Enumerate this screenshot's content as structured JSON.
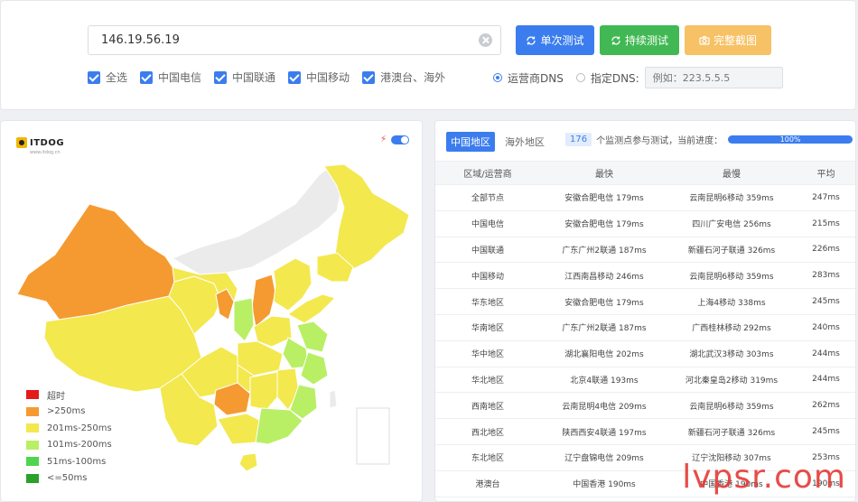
{
  "search": {
    "value": "146.19.56.19"
  },
  "buttons": {
    "single": "单次测试",
    "continuous": "持续测试",
    "screenshot": "完整截图"
  },
  "filters": [
    "全选",
    "中国电信",
    "中国联通",
    "中国移动",
    "港澳台、海外"
  ],
  "dns": {
    "isp_label": "运营商DNS",
    "custom_label": "指定DNS:",
    "placeholder": "例如：223.5.5.5"
  },
  "map": {
    "logo": "ITDOG",
    "logo_sub": "www.itdog.cn",
    "legend": [
      {
        "label": "超时",
        "color": "#e41b1b"
      },
      {
        "label": ">250ms",
        "color": "#f59a31"
      },
      {
        "label": "201ms-250ms",
        "color": "#f3e84e"
      },
      {
        "label": "101ms-200ms",
        "color": "#b8ef65"
      },
      {
        "label": "51ms-100ms",
        "color": "#4fd54d"
      },
      {
        "label": "<=50ms",
        "color": "#2aa12a"
      }
    ]
  },
  "results": {
    "tabs": [
      "中国地区",
      "海外地区"
    ],
    "count": "176",
    "count_text": "个监测点参与测试，当前进度：",
    "progress": "100%",
    "headers": [
      "区域/运营商",
      "最快",
      "最慢",
      "平均"
    ],
    "rows": [
      [
        "全部节点",
        "安徽合肥电信 179ms",
        "云南昆明6移动 359ms",
        "247ms"
      ],
      [
        "中国电信",
        "安徽合肥电信 179ms",
        "四川广安电信 256ms",
        "215ms"
      ],
      [
        "中国联通",
        "广东广州2联通 187ms",
        "新疆石河子联通 326ms",
        "226ms"
      ],
      [
        "中国移动",
        "江西南昌移动 246ms",
        "云南昆明6移动 359ms",
        "283ms"
      ],
      [
        "华东地区",
        "安徽合肥电信 179ms",
        "上海4移动 338ms",
        "245ms"
      ],
      [
        "华南地区",
        "广东广州2联通 187ms",
        "广西桂林移动 292ms",
        "240ms"
      ],
      [
        "华中地区",
        "湖北襄阳电信 202ms",
        "湖北武汉3移动 303ms",
        "244ms"
      ],
      [
        "华北地区",
        "北京4联通 193ms",
        "河北秦皇岛2移动 319ms",
        "244ms"
      ],
      [
        "西南地区",
        "云南昆明4电信 209ms",
        "云南昆明6移动 359ms",
        "262ms"
      ],
      [
        "西北地区",
        "陕西西安4联通 197ms",
        "新疆石河子联通 326ms",
        "245ms"
      ],
      [
        "东北地区",
        "辽宁盘锦电信 209ms",
        "辽宁沈阳移动 307ms",
        "253ms"
      ],
      [
        "港澳台",
        "中国香港 190ms",
        "中国香港 190ms",
        "190ms"
      ]
    ]
  },
  "watermark": "lvpsr.com"
}
